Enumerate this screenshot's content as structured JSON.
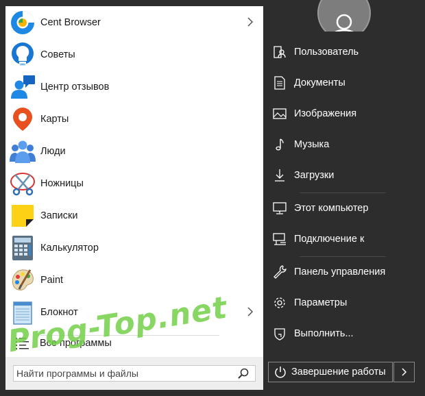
{
  "apps": [
    {
      "label": "Cent Browser",
      "icon": "cent-browser-icon",
      "has_submenu": true
    },
    {
      "label": "Советы",
      "icon": "tips-lightbulb-icon",
      "has_submenu": false
    },
    {
      "label": "Центр отзывов",
      "icon": "feedback-hub-icon",
      "has_submenu": false
    },
    {
      "label": "Карты",
      "icon": "maps-pin-icon",
      "has_submenu": false
    },
    {
      "label": "Люди",
      "icon": "people-icon",
      "has_submenu": false
    },
    {
      "label": "Ножницы",
      "icon": "snipping-scissors-icon",
      "has_submenu": false
    },
    {
      "label": "Записки",
      "icon": "sticky-notes-icon",
      "has_submenu": false
    },
    {
      "label": "Калькулятор",
      "icon": "calculator-icon",
      "has_submenu": false
    },
    {
      "label": "Paint",
      "icon": "paint-palette-icon",
      "has_submenu": false
    },
    {
      "label": "Блокнот",
      "icon": "notepad-icon",
      "has_submenu": true
    }
  ],
  "all_programs": {
    "label": "Все программы",
    "icon": "all-programs-list-icon"
  },
  "search": {
    "placeholder": "Найти программы и файлы",
    "icon": "search-icon"
  },
  "user": {
    "icon": "user-avatar-icon"
  },
  "places": [
    {
      "label": "Пользователь",
      "icon": "user-folder-icon"
    },
    {
      "label": "Документы",
      "icon": "documents-icon"
    },
    {
      "label": "Изображения",
      "icon": "pictures-icon"
    },
    {
      "label": "Музыка",
      "icon": "music-note-icon"
    },
    {
      "label": "Загрузки",
      "icon": "download-arrow-icon"
    },
    {
      "label": "Этот компьютер",
      "icon": "computer-monitor-icon"
    },
    {
      "label": "Подключение к",
      "icon": "connect-to-network-icon"
    },
    {
      "label": "Панель управления",
      "icon": "control-panel-wrench-icon"
    },
    {
      "label": "Параметры",
      "icon": "settings-gear-icon"
    },
    {
      "label": "Выполнить...",
      "icon": "run-shield-icon"
    }
  ],
  "shutdown": {
    "label": "Завершение работы",
    "icon": "power-icon",
    "arrow_icon": "chevron-right-icon"
  },
  "watermark": {
    "text": "Prog-Top.net"
  },
  "colors": {
    "panel_bg": "#2d2d2d",
    "left_bg": "#ffffff",
    "watermark": "#5ac828"
  }
}
